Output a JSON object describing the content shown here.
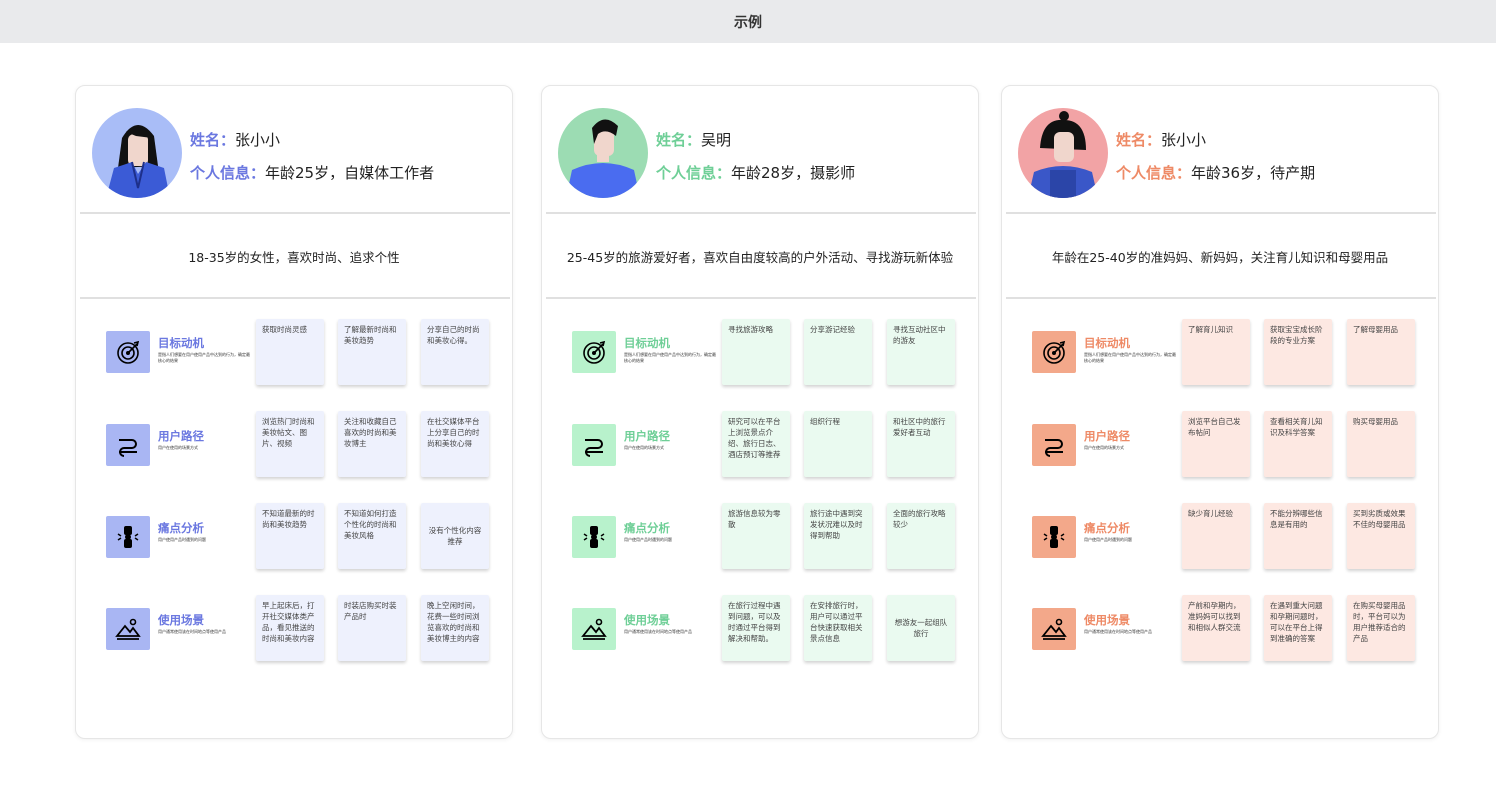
{
  "topbar": {
    "title": "示例"
  },
  "cards": [
    {
      "name_label": "姓名：",
      "name_value": "张小小",
      "info_label": "个人信息：",
      "info_value": "年龄25岁，自媒体工作者",
      "description": "18-35岁的女性，喜欢时尚、追求个性",
      "accent": "#6b78e0",
      "icon_bg": "#a9b6f3",
      "note_bg": "#eef1fd",
      "avatar_bg": "#a9bdf7",
      "sections": [
        {
          "title": "目标动机",
          "subtitle": "是指人们想要在用户使用产品中达到的行为，确定最核心的结果",
          "icon": "target-icon",
          "notes": [
            "获取时尚灵感",
            "了解最新时尚和美妆趋势",
            "分享自己的时尚和美妆心得。"
          ]
        },
        {
          "title": "用户路径",
          "subtitle": "用户在使用的场景方式",
          "icon": "path-icon",
          "notes": [
            "浏览热门时尚和美妆帖文、图片、视频",
            "关注和收藏自己喜欢的时尚和美妆博主",
            "在社交媒体平台上分享自己的时尚和美妆心得"
          ]
        },
        {
          "title": "痛点分析",
          "subtitle": "用户使用产品时遇到的问题",
          "icon": "pain-icon",
          "notes": [
            "不知道最新的时尚和美妆趋势",
            "不知道如何打造个性化的时尚和美妆风格",
            "没有个性化内容推荐"
          ]
        },
        {
          "title": "使用场景",
          "subtitle": "用户通常使用该在时间地点等使用产品",
          "icon": "scene-icon",
          "notes": [
            "早上起床后，打开社交媒体类产品，看见推送的时尚和美妆内容",
            "时装店购买时装产品时",
            "晚上空闲时间，花费一些时间浏览喜欢的时尚和美妆博主的内容"
          ]
        }
      ]
    },
    {
      "name_label": "姓名：",
      "name_value": "吴明",
      "info_label": "个人信息：",
      "info_value": "年龄28岁，摄影师",
      "description": "25-45岁的旅游爱好者，喜欢自由度较高的户外活动、寻找游玩新体验",
      "accent": "#6fcf97",
      "icon_bg": "#b8f2cc",
      "note_bg": "#eafaf0",
      "avatar_bg": "#9cdcb3",
      "sections": [
        {
          "title": "目标动机",
          "subtitle": "是指人们想要在用户使用产品中达到的行为，确定最核心的结果",
          "icon": "target-icon",
          "notes": [
            "寻找旅游攻略",
            "分享游记经验",
            "寻找互动社区中的游友"
          ]
        },
        {
          "title": "用户路径",
          "subtitle": "用户在使用的场景方式",
          "icon": "path-icon",
          "notes": [
            "研究可以在平台上浏览景点介绍、旅行日志、酒店预订等推荐",
            "组织行程",
            "和社区中的旅行爱好者互动"
          ]
        },
        {
          "title": "痛点分析",
          "subtitle": "用户使用产品时遇到的问题",
          "icon": "pain-icon",
          "notes": [
            "旅游信息较为零散",
            "旅行途中遇到突发状况难以及时得到帮助",
            "全面的旅行攻略较少"
          ]
        },
        {
          "title": "使用场景",
          "subtitle": "用户通常使用该在时间地点等使用产品",
          "icon": "scene-icon",
          "notes": [
            "在旅行过程中遇到问题，可以及时通过平台得到解决和帮助。",
            "在安排旅行时，用户可以通过平台快速获取相关景点信息",
            "想游友一起组队旅行"
          ]
        }
      ]
    },
    {
      "name_label": "姓名：",
      "name_value": "张小小",
      "info_label": "个人信息：",
      "info_value": "年龄36岁，待产期",
      "description": "年龄在25-40岁的准妈妈、新妈妈，关注育儿知识和母婴用品",
      "accent": "#ee8a66",
      "icon_bg": "#f3a88a",
      "note_bg": "#fde8e2",
      "avatar_bg": "#f2a3a5",
      "sections": [
        {
          "title": "目标动机",
          "subtitle": "是指人们想要在用户使用产品中达到的行为，确定最核心的结果",
          "icon": "target-icon",
          "notes": [
            "了解育儿知识",
            "获取宝宝成长阶段的专业方案",
            "了解母婴用品"
          ]
        },
        {
          "title": "用户路径",
          "subtitle": "用户在使用的场景方式",
          "icon": "path-icon",
          "notes": [
            "浏览平台自己发布帖问",
            "查看相关育儿知识及科学答案",
            "购买母婴用品"
          ]
        },
        {
          "title": "痛点分析",
          "subtitle": "用户使用产品时遇到的问题",
          "icon": "pain-icon",
          "notes": [
            "缺少育儿经验",
            "不能分辨哪些信息是有用的",
            "买到劣质或效果不佳的母婴用品"
          ]
        },
        {
          "title": "使用场景",
          "subtitle": "用户通常使用该在时间地点等使用产品",
          "icon": "scene-icon",
          "notes": [
            "产前和孕期内，准妈妈可以找到和相似人群交流",
            "在遇到重大问题和孕期问题时，可以在平台上得到准确的答案",
            "在购买母婴用品时，平台可以为用户推荐适合的产品"
          ]
        }
      ]
    }
  ]
}
